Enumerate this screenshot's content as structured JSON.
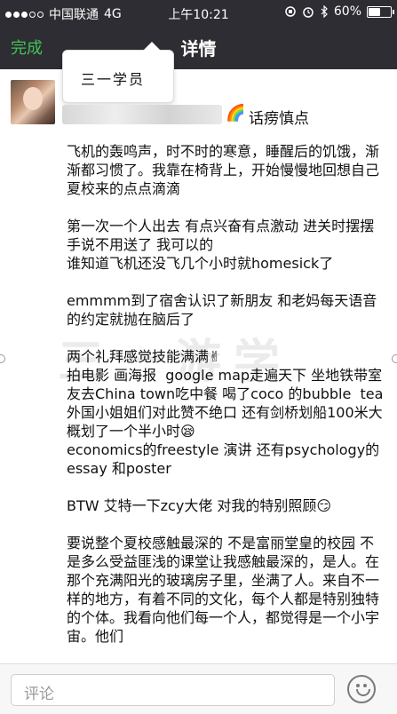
{
  "status_bar": {
    "carrier": "中国联通",
    "network": "4G",
    "time": "上午10:21",
    "battery": "60%",
    "battery_level": 0.6
  },
  "nav": {
    "done_label": "完成",
    "title": "详情"
  },
  "post": {
    "tag": "三一学员",
    "username": "话痨慎点",
    "emoji_rainbow": "🌈",
    "paragraphs": [
      "飞机的轰鸣声，时不时的寒意，睡醒后的饥饿，渐渐都习惯了。我靠在椅背上，开始慢慢地回想自己夏校来的点点滴滴",
      "第一次一个人出去 有点兴奋有点激动 进关时摆摆手说不用送了 我可以的\n谁知道飞机还没飞几个小时就homesick了",
      "emmmm到了宿舍认识了新朋友 和老妈每天语音的约定就抛在脑后了",
      "两个礼拜感觉技能满满✌\n拍电影 画海报  google map走遍天下 坐地铁带室友去China town吃中餐 喝了coco 的bubble  tea 外国小姐姐们对此赞不绝口 还有剑桥划船100米大概划了一个半小时😪\neconomics的freestyle 演讲 还有psychology的essay 和poster",
      "BTW 艾特一下zcy大佬 对我的特别照顾😏",
      "要说整个夏校感触最深的 不是富丽堂皇的校园 不是多么受益匪浅的课堂让我感触最深的，是人。在那个充满阳光的玻璃房子里，坐满了人。来自不一样的地方，有着不同的文化，每个人都是特别独特的个体。我看向他们每一个人，都觉得是一个小宇宙。他们"
    ]
  },
  "watermark": "三一游学",
  "bottom": {
    "comment_placeholder": "评论"
  },
  "colors": {
    "bar": "#2d2d33",
    "accent_green": "#41c356"
  }
}
